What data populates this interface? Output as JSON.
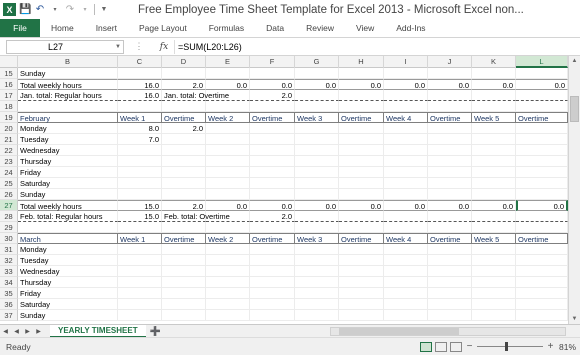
{
  "window": {
    "title": "Free Employee Time Sheet Template for Excel 2013  -  Microsoft Excel non...",
    "app_icon": "X"
  },
  "ribbon": {
    "tabs": [
      "File",
      "Home",
      "Insert",
      "Page Layout",
      "Formulas",
      "Data",
      "Review",
      "View",
      "Add-Ins"
    ]
  },
  "formula_bar": {
    "name_box": "L27",
    "fx": "fx",
    "dots": "⋮",
    "formula": "=SUM(L20:L26)"
  },
  "columns": [
    "B",
    "C",
    "D",
    "E",
    "F",
    "G",
    "H",
    "I",
    "J",
    "K",
    "L"
  ],
  "selected_column": "L",
  "rows": [
    {
      "n": "15",
      "type": "plain",
      "cells": [
        "Sunday",
        "",
        "",
        "",
        "",
        "",
        "",
        "",
        "",
        "",
        ""
      ]
    },
    {
      "n": "16",
      "type": "total",
      "cells": [
        "Total weekly hours",
        "16.0",
        "2.0",
        "0.0",
        "0.0",
        "0.0",
        "0.0",
        "0.0",
        "0.0",
        "0.0",
        "0.0"
      ]
    },
    {
      "n": "17",
      "type": "reg",
      "cells": [
        "Jan. total: Regular hours",
        "16.0",
        "Jan. total: Overtime",
        "",
        "2.0",
        "",
        "",
        "",
        "",
        "",
        ""
      ]
    },
    {
      "n": "18",
      "type": "plain",
      "cells": [
        "",
        "",
        "",
        "",
        "",
        "",
        "",
        "",
        "",
        "",
        ""
      ]
    },
    {
      "n": "19",
      "type": "hdr",
      "cells": [
        "February",
        "Week 1",
        "Overtime",
        "Week 2",
        "Overtime",
        "Week 3",
        "Overtime",
        "Week 4",
        "Overtime",
        "Week 5",
        "Overtime"
      ]
    },
    {
      "n": "20",
      "type": "plain",
      "cells": [
        "Monday",
        "8.0",
        "2.0",
        "",
        "",
        "",
        "",
        "",
        "",
        "",
        ""
      ]
    },
    {
      "n": "21",
      "type": "plain",
      "cells": [
        "Tuesday",
        "7.0",
        "",
        "",
        "",
        "",
        "",
        "",
        "",
        "",
        ""
      ]
    },
    {
      "n": "22",
      "type": "plain",
      "cells": [
        "Wednesday",
        "",
        "",
        "",
        "",
        "",
        "",
        "",
        "",
        "",
        ""
      ]
    },
    {
      "n": "23",
      "type": "plain",
      "cells": [
        "Thursday",
        "",
        "",
        "",
        "",
        "",
        "",
        "",
        "",
        "",
        ""
      ]
    },
    {
      "n": "24",
      "type": "plain",
      "cells": [
        "Friday",
        "",
        "",
        "",
        "",
        "",
        "",
        "",
        "",
        "",
        ""
      ]
    },
    {
      "n": "25",
      "type": "plain",
      "cells": [
        "Saturday",
        "",
        "",
        "",
        "",
        "",
        "",
        "",
        "",
        "",
        ""
      ]
    },
    {
      "n": "26",
      "type": "plain",
      "cells": [
        "Sunday",
        "",
        "",
        "",
        "",
        "",
        "",
        "",
        "",
        "",
        ""
      ]
    },
    {
      "n": "27",
      "type": "total",
      "cells": [
        "Total weekly hours",
        "15.0",
        "2.0",
        "0.0",
        "0.0",
        "0.0",
        "0.0",
        "0.0",
        "0.0",
        "0.0",
        "0.0"
      ]
    },
    {
      "n": "28",
      "type": "reg",
      "cells": [
        "Feb. total: Regular hours",
        "15.0",
        "Feb. total: Overtime",
        "",
        "2.0",
        "",
        "",
        "",
        "",
        "",
        ""
      ]
    },
    {
      "n": "29",
      "type": "plain",
      "cells": [
        "",
        "",
        "",
        "",
        "",
        "",
        "",
        "",
        "",
        "",
        ""
      ]
    },
    {
      "n": "30",
      "type": "hdr",
      "cells": [
        "March",
        "Week 1",
        "Overtime",
        "Week 2",
        "Overtime",
        "Week 3",
        "Overtime",
        "Week 4",
        "Overtime",
        "Week 5",
        "Overtime"
      ]
    },
    {
      "n": "31",
      "type": "plain",
      "cells": [
        "Monday",
        "",
        "",
        "",
        "",
        "",
        "",
        "",
        "",
        "",
        ""
      ]
    },
    {
      "n": "32",
      "type": "plain",
      "cells": [
        "Tuesday",
        "",
        "",
        "",
        "",
        "",
        "",
        "",
        "",
        "",
        ""
      ]
    },
    {
      "n": "33",
      "type": "plain",
      "cells": [
        "Wednesday",
        "",
        "",
        "",
        "",
        "",
        "",
        "",
        "",
        "",
        ""
      ]
    },
    {
      "n": "34",
      "type": "plain",
      "cells": [
        "Thursday",
        "",
        "",
        "",
        "",
        "",
        "",
        "",
        "",
        "",
        ""
      ]
    },
    {
      "n": "35",
      "type": "plain",
      "cells": [
        "Friday",
        "",
        "",
        "",
        "",
        "",
        "",
        "",
        "",
        "",
        ""
      ]
    },
    {
      "n": "36",
      "type": "plain",
      "cells": [
        "Saturday",
        "",
        "",
        "",
        "",
        "",
        "",
        "",
        "",
        "",
        ""
      ]
    },
    {
      "n": "37",
      "type": "plain",
      "cells": [
        "Sunday",
        "",
        "",
        "",
        "",
        "",
        "",
        "",
        "",
        "",
        ""
      ]
    }
  ],
  "active_cell": {
    "row": "27",
    "col": "L"
  },
  "sheet": {
    "tab": "YEARLY TIMESHEET"
  },
  "status": {
    "ready": "Ready",
    "zoom": "81%",
    "minus": "−",
    "plus": "+"
  },
  "colors": {
    "accent": "#217346",
    "header_text": "#1f3864"
  }
}
